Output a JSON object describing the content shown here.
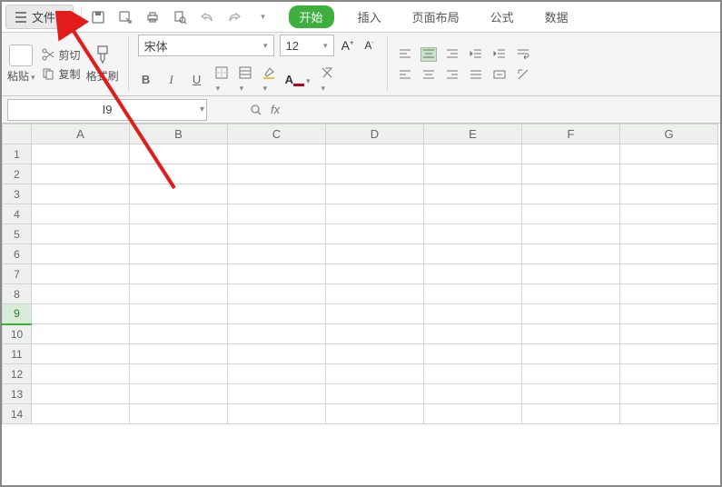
{
  "menubar": {
    "file_label": "文件",
    "tabs": {
      "start": "开始",
      "insert": "插入",
      "layout": "页面布局",
      "formula": "公式",
      "data": "数据"
    }
  },
  "ribbon": {
    "paste_label": "粘贴",
    "cut_label": "剪切",
    "copy_label": "复制",
    "brush_label": "格式刷",
    "font_name": "宋体",
    "font_size": "12",
    "bold": "B",
    "italic": "I",
    "underline": "U"
  },
  "namebox": {
    "value": "I9"
  },
  "formula": {
    "fx": "fx",
    "value": ""
  },
  "grid": {
    "columns": [
      "A",
      "B",
      "C",
      "D",
      "E",
      "F",
      "G"
    ],
    "rows": [
      "1",
      "2",
      "3",
      "4",
      "5",
      "6",
      "7",
      "8",
      "9",
      "10",
      "11",
      "12",
      "13",
      "14"
    ],
    "selected_row": "9"
  }
}
